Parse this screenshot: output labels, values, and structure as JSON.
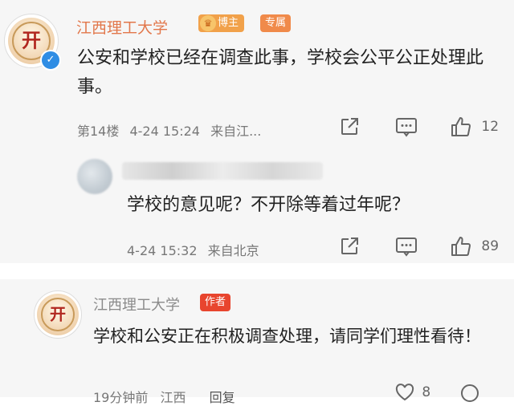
{
  "comment1": {
    "author": "江西理工大学",
    "badge_host": "博主",
    "badge_special": "专属",
    "text": "公安和学校已经在调查此事，学校会公平公正处理此事。",
    "floor": "第14楼",
    "datetime": "4-24 15:24",
    "location": "来自江...",
    "like_count": "12"
  },
  "reply": {
    "text": "学校的意见呢？不开除等着过年呢？",
    "datetime": "4-24 15:32",
    "location": "来自北京",
    "like_count": "89"
  },
  "comment2": {
    "author": "江西理工大学",
    "badge_author": "作者",
    "text": "学校和公安正在积极调查处理，请同学们理性看待！",
    "time": "19分钟前",
    "location": "江西",
    "reply_label": "回复",
    "like_count": "8"
  },
  "colors": {
    "author_name": "#e2774b",
    "host_badge": "#f1a14a",
    "author_badge": "#e8452e",
    "verified": "#2f8de4"
  },
  "icons": [
    "verified-icon",
    "crown-icon",
    "share-icon",
    "comment-icon",
    "like-icon"
  ]
}
